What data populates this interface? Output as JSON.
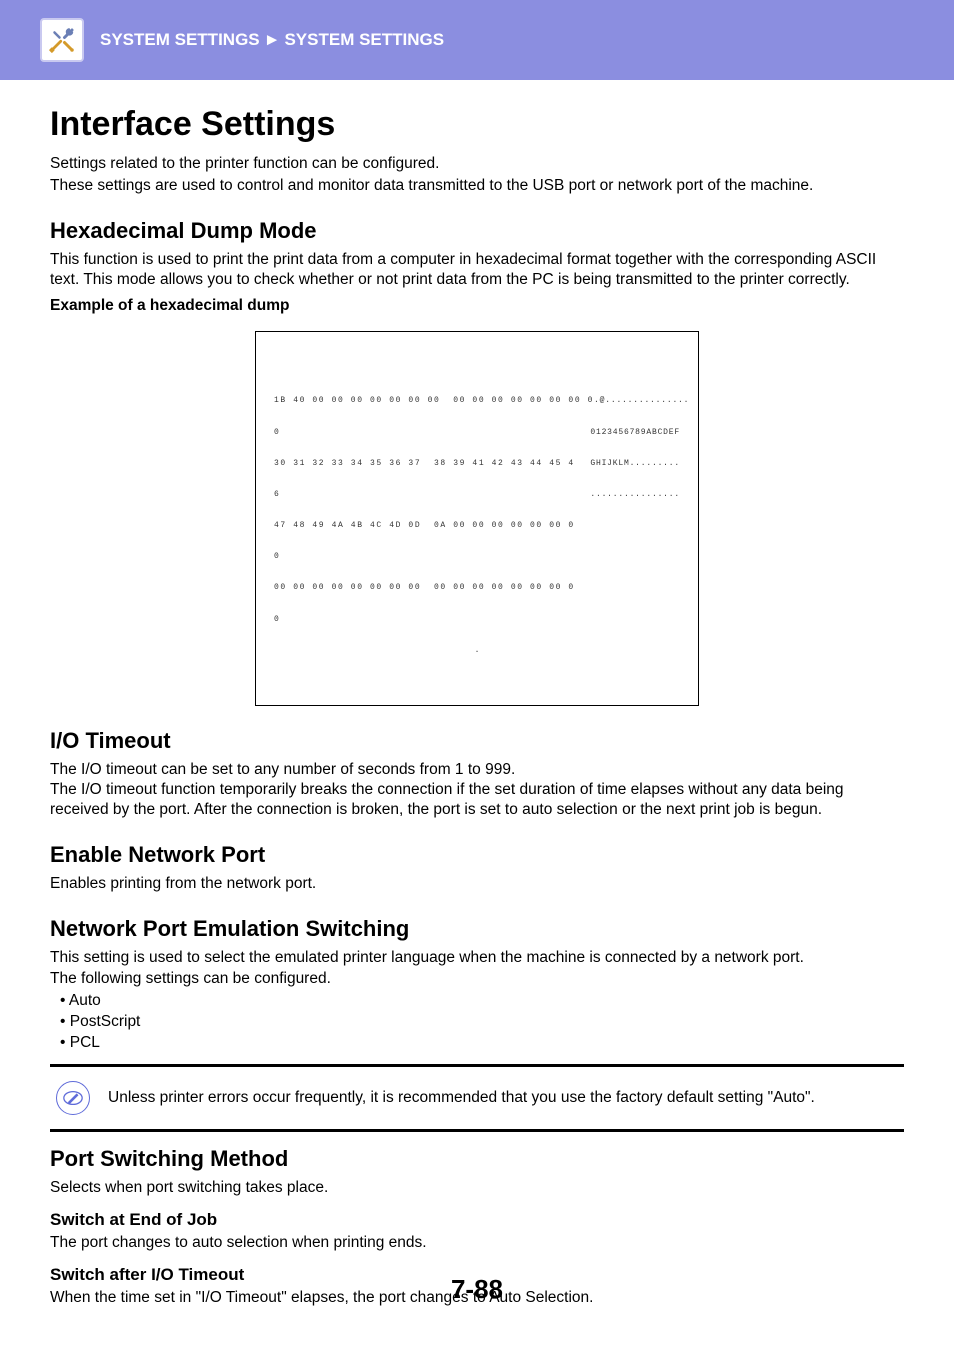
{
  "header": {
    "crumb1": "SYSTEM SETTINGS",
    "sep": "►",
    "crumb2": "SYSTEM SETTINGS"
  },
  "title": "Interface Settings",
  "intro": {
    "p1": "Settings related to the printer function can be configured.",
    "p2": "These settings are used to control and monitor data transmitted to the USB port or network port of the machine."
  },
  "hex": {
    "heading": "Hexadecimal Dump Mode",
    "p1": "This function is used to print the print data from a computer in hexadecimal format together with the corresponding ASCII text. This mode allows you to check whether or not print data from the PC is being transmitted to the printer correctly.",
    "label": "Example of a hexadecimal dump",
    "dump": {
      "r1_hex": "1B 40 00 00 00 00 00 00 00  00 00 00 00 00 00 00 0",
      "r1_ascii": ".@...............",
      "r1b": "0",
      "r2_hex": "30 31 32 33 34 35 36 37  38 39 41 42 43 44 45 4",
      "r2_ascii": "0123456789ABCDEF",
      "r2b": "6",
      "r3_hex": "47 48 49 4A 4B 4C 4D 0D  0A 00 00 00 00 00 00 0",
      "r3_ascii": "GHIJKLM.........",
      "r3b": "0",
      "r4_hex": "00 00 00 00 00 00 00 00  00 00 00 00 00 00 00 0",
      "r4_ascii": "................",
      "r4b": "0"
    }
  },
  "io": {
    "heading": "I/O Timeout",
    "p1": "The I/O timeout can be set to any number of seconds from 1 to 999.",
    "p2": "The I/O timeout function temporarily breaks the connection if the set duration of time elapses without any data being received by the port. After the connection is broken, the port is set to auto selection or the next print job is begun."
  },
  "enp": {
    "heading": "Enable Network Port",
    "p1": "Enables printing from the network port."
  },
  "npes": {
    "heading": "Network Port Emulation Switching",
    "p1": "This setting is used to select the emulated printer language when the machine is connected by a network port.",
    "p2": "The following settings can be configured.",
    "b1": "• Auto",
    "b2": "• PostScript",
    "b3": "• PCL",
    "note": "Unless printer errors occur frequently, it is recommended that you use the factory default setting \"Auto\"."
  },
  "psm": {
    "heading": "Port Switching Method",
    "p1": "Selects when port switching takes place.",
    "s1h": "Switch at End of Job",
    "s1p": "The port changes to auto selection when printing ends.",
    "s2h": "Switch after I/O Timeout",
    "s2p": "When the time set in \"I/O Timeout\" elapses, the port changes to Auto Selection."
  },
  "page_number": "7-88"
}
